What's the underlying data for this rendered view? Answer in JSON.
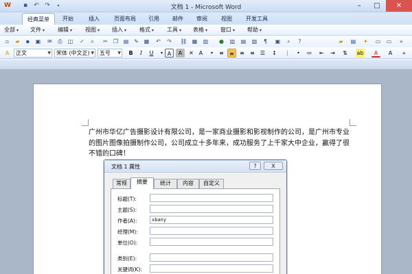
{
  "window": {
    "title": "文档 1 - Microsoft Word",
    "minimize": "–",
    "maximize": "□",
    "close": "✕"
  },
  "ribbon_tabs": [
    "经典菜单",
    "开始",
    "插入",
    "页面布局",
    "引用",
    "邮件",
    "审阅",
    "视图",
    "开发工具"
  ],
  "menus": [
    "全部",
    "文件",
    "编辑",
    "视图",
    "插入",
    "格式",
    "工具",
    "表格",
    "窗口",
    "帮助"
  ],
  "format": {
    "style": "正文",
    "font": "宋体 (中文正)",
    "size": "五号",
    "bold": "B",
    "italic": "I",
    "underline": "U",
    "char_border": "A",
    "char_shading": "A",
    "font_color_a": "A"
  },
  "document": {
    "paragraph": "广州市华亿广告摄影设计有限公司，是一家商业摄影和影视制作的公司，是广州市专业的图片图像拍摄制作公司，公司成立十多年来，成功服务了上千家大中企业，赢得了很不错的口碑！"
  },
  "dialog": {
    "title": "文档 1 属性",
    "help": "?",
    "close": "X",
    "tabs": [
      "常规",
      "摘要",
      "统计",
      "内容",
      "自定义"
    ],
    "active_tab": "摘要",
    "fields": [
      {
        "label": "标题(T):",
        "value": ""
      },
      {
        "label": "主题(S):",
        "value": ""
      },
      {
        "label": "作者(A):",
        "value": "xbany"
      },
      {
        "label": "经理(M):",
        "value": ""
      },
      {
        "label": "单位(O):",
        "value": ""
      },
      {
        "label": "类别(E):",
        "value": ""
      },
      {
        "label": "关键词(K):",
        "value": ""
      }
    ]
  }
}
